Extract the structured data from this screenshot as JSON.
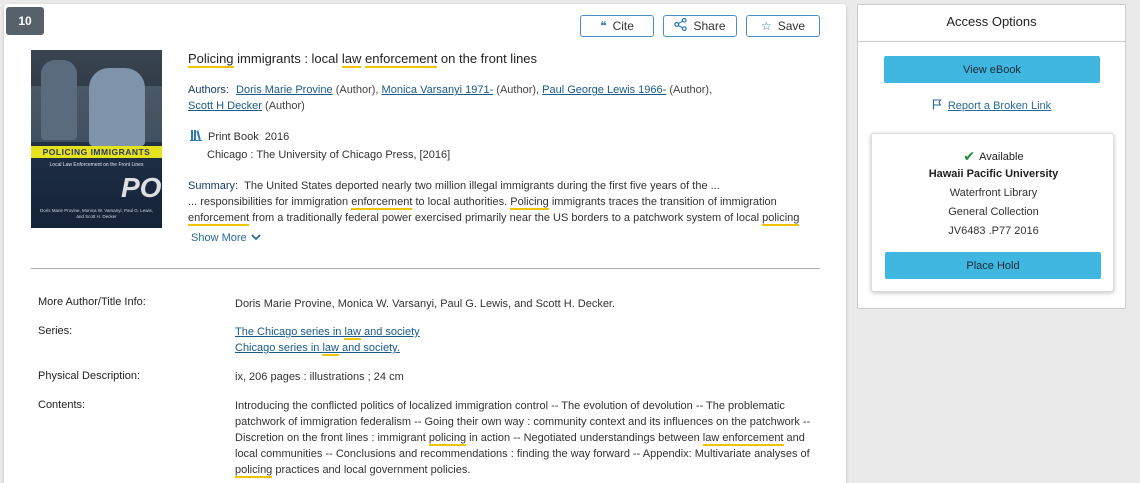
{
  "result": {
    "number": "10"
  },
  "actions": {
    "cite": "Cite",
    "share": "Share",
    "save": "Save"
  },
  "cover": {
    "title": "POLICING IMMIGRANTS",
    "subtitle": "Local Law Enforcement on the Front Lines",
    "authors": "Doris Marie Provine, Monica W. Varsanyi, Paul G. Lewis, and Scott H. Decker"
  },
  "book": {
    "title_parts": [
      "Policing",
      " immigrants : local ",
      "law",
      " ",
      "enforcement",
      " on the front lines"
    ],
    "authors_label": "Authors:",
    "authors": [
      {
        "name": "Doris Marie Provine",
        "role": "(Author),"
      },
      {
        "name": "Monica Varsanyi 1971-",
        "role": "(Author),"
      },
      {
        "name": "Paul George Lewis 1966-",
        "role": "(Author),"
      },
      {
        "name": "Scott H Decker",
        "role": "(Author)"
      }
    ],
    "format": "Print Book",
    "year": "2016",
    "publisher": "Chicago : The University of Chicago Press, [2016]",
    "summary_label": "Summary:",
    "summary_line1": "The United States deported nearly two million illegal immigrants during the first five years of the ...",
    "summary_line2a": "... responsibilities for immigration ",
    "summary_hl1": "enforcement",
    "summary_line2b": " to local authorities. ",
    "summary_hl2": "Policing",
    "summary_line2c": " immigrants traces the transition of immigration",
    "summary_hl3": "enforcement",
    "summary_line3b": " from a traditionally federal power exercised primarily near the US borders to a patchwork system of local ",
    "summary_hl4": "policing",
    "show_more": "Show More"
  },
  "details": {
    "more_info_label": "More Author/Title Info:",
    "more_info_value": "Doris Marie Provine, Monica W. Varsanyi, Paul G. Lewis, and Scott H. Decker.",
    "series_label": "Series:",
    "series1_a": "The Chicago series in ",
    "series1_hl": "law",
    "series1_b": " and society",
    "series2_a": "Chicago series in ",
    "series2_hl": "law",
    "series2_b": " and society.",
    "physical_label": "Physical Description:",
    "physical_value": "ix, 206 pages : illustrations ; 24 cm",
    "contents_label": "Contents:",
    "contents_1": "Introducing the conflicted politics of localized immigration control -- The evolution of devolution -- The problematic patchwork of immigration federalism -- Going their own way : community context and its influences on the patchwork -- Discretion on the front lines : immigrant ",
    "contents_hl1": "policing",
    "contents_2": " in action -- Negotiated understandings between ",
    "contents_hl2": "law enforcement",
    "contents_3": " and local communities -- Conclusions and recommendations : finding the way forward -- Appendix: Multivariate analyses of ",
    "contents_hl3": "policing",
    "contents_4": " practices and local government policies."
  },
  "access": {
    "title": "Access Options",
    "view_ebook": "View eBook",
    "report_link": "Report a Broken Link",
    "availability": "Available",
    "institution": "Hawaii Pacific University",
    "library": "Waterfront Library",
    "collection": "General Collection",
    "call_number": "JV6483 .P77 2016",
    "place_hold": "Place Hold"
  }
}
